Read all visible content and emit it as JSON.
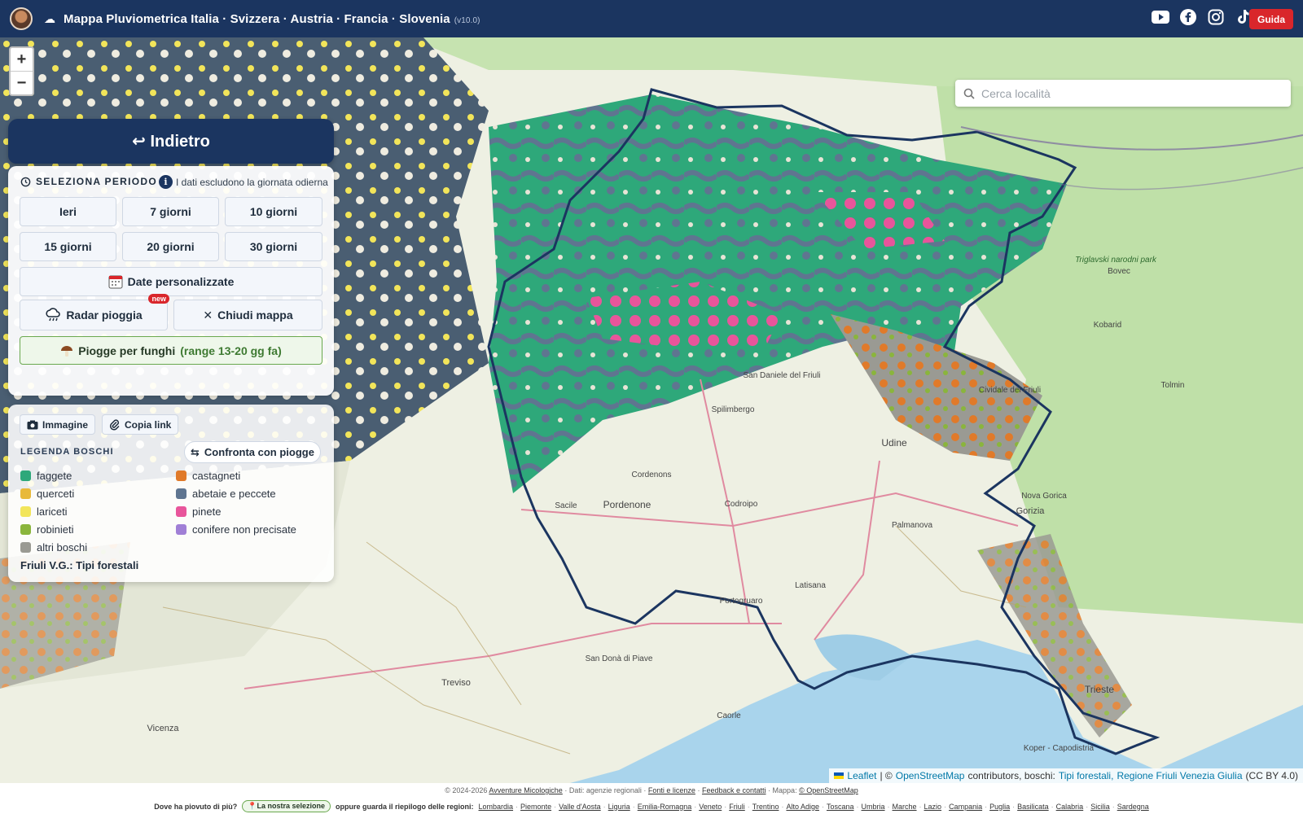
{
  "header": {
    "title": "Mappa Pluviometrica Italia · Svizzera · Austria · Francia · Slovenia",
    "version": "(v10.0)",
    "guide_label": "Guida",
    "social_icons": [
      "youtube-icon",
      "facebook-icon",
      "instagram-icon",
      "tiktok-icon"
    ],
    "colors": {
      "bar": "#1b3560",
      "guide": "#d9262b"
    }
  },
  "map": {
    "zoom_in": "+",
    "zoom_out": "−",
    "search_placeholder": "Cerca località"
  },
  "panel": {
    "back_label": "↩ Indietro",
    "period_title": "SELEZIONA PERIODO",
    "info_text": "I dati escludono la giornata odierna",
    "periods": [
      "Ieri",
      "7 giorni",
      "10 giorni",
      "15 giorni",
      "20 giorni",
      "30 giorni"
    ],
    "custom_dates": "Date personalizzate",
    "radar_label": "Radar pioggia",
    "new_badge": "new",
    "close_map": "Chiudi mappa",
    "funghi_label": "Piogge per funghi",
    "funghi_range": "(range 13-20 gg fa)"
  },
  "legend": {
    "image_btn": "Immagine",
    "copy_btn": "Copia link",
    "title": "LEGENDA BOSCHI",
    "compare_btn": "Confronta con piogge",
    "items": [
      {
        "label": "faggete",
        "color": "#2ea87a"
      },
      {
        "label": "querceti",
        "color": "#e8b93a"
      },
      {
        "label": "lariceti",
        "color": "#f2e55a"
      },
      {
        "label": "robinieti",
        "color": "#8ab53c"
      },
      {
        "label": "altri boschi",
        "color": "#9a9a93"
      },
      {
        "label": "castagneti",
        "color": "#e07a2a"
      },
      {
        "label": "abetaie e peccete",
        "color": "#5f7590"
      },
      {
        "label": "pinete",
        "color": "#e8559b"
      },
      {
        "label": "conifere non precisate",
        "color": "#a07fd6"
      }
    ],
    "source": "Friuli V.G.: Tipi forestali"
  },
  "attribution": {
    "leaflet": "Leaflet",
    "sep": "| ©",
    "osm": "OpenStreetMap",
    "mid": "contributors, boschi:",
    "tipi": "Tipi forestali,",
    "regione": "Regione Friuli Venezia Giulia",
    "license": "(CC BY 4.0)"
  },
  "footer": {
    "copyright": "© 2024-2026",
    "site": "Avventure Micologiche",
    "data": "· Dati: agenzie regionali ·",
    "licenses": "Fonti e licenze",
    "dot1": "·",
    "feedback": "Feedback e contatti",
    "map_label": "· Mappa:",
    "map_link": "© OpenStreetMap",
    "question": "Dove ha piovuto di più?",
    "selection": "La nostra selezione",
    "or_text": "oppure guarda il riepilogo delle regioni:",
    "regions": [
      "Lombardia",
      "Piemonte",
      "Valle d'Aosta",
      "Liguria",
      "Emilia-Romagna",
      "Veneto",
      "Friuli",
      "Trentino",
      "Alto Adige",
      "Toscana",
      "Umbria",
      "Marche",
      "Lazio",
      "Campania",
      "Puglia",
      "Basilicata",
      "Calabria",
      "Sicilia",
      "Sardegna"
    ]
  },
  "place_labels": [
    "Udine",
    "Pordenone",
    "Gorizia",
    "Trieste",
    "Nova Gorica",
    "Koper - Capodistria",
    "Treviso",
    "Vicenza",
    "Palmanova",
    "Codroipo",
    "Spilimbergo",
    "San Daniele del Friuli",
    "Tolmin",
    "Bovec",
    "Kobarid",
    "Cividale del Friuli",
    "Portogruaro",
    "Latisana",
    "San Donà di Piave",
    "Caorle",
    "Cordenons",
    "Sacile",
    "Triglavski narodni park"
  ]
}
